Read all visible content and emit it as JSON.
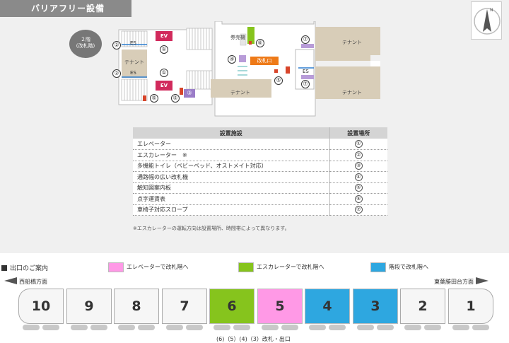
{
  "header": {
    "title": "バリアフリー設備"
  },
  "floor_badge": {
    "line1": "２階",
    "line2": "(改札階)"
  },
  "map": {
    "ev_label": "EV",
    "es_label": "ES",
    "tenant_label": "テナント",
    "ticket_machine_label": "券売機",
    "gate_label": "改札口",
    "markers": [
      "②",
      "①",
      "②",
      "①",
      "⑤",
      "⑤",
      "③",
      "④",
      "⑥",
      "⑦",
      "⑦",
      "⑤"
    ]
  },
  "facility_table": {
    "col_facility": "設置施設",
    "col_location": "設置場所",
    "rows": [
      {
        "name": "エレベーター",
        "mark": "①"
      },
      {
        "name": "エスカレーター　※",
        "mark": "②"
      },
      {
        "name": "多機能トイレ（ベビーベッド、オストメイト対応）",
        "mark": "③"
      },
      {
        "name": "通路幅の広い改札機",
        "mark": "④"
      },
      {
        "name": "触知図案内板",
        "mark": "⑤"
      },
      {
        "name": "点字運賃表",
        "mark": "⑥"
      },
      {
        "name": "車椅子対応スロープ",
        "mark": "⑦"
      }
    ],
    "note": "※エスカレーターの運転方向は設置場所、時間帯によって異なります。"
  },
  "exit_guide": {
    "title": "出口のご案内",
    "legend": [
      {
        "label": "エレベーターで改札階へ",
        "color": "#ff99e6"
      },
      {
        "label": "エスカレーターで改札階へ",
        "color": "#86c41d"
      },
      {
        "label": "階段で改札階へ",
        "color": "#2ea7e0"
      }
    ],
    "direction_left": "西船橋方面",
    "direction_right": "東葉勝田台方面",
    "cars": [
      {
        "number": "10",
        "color": "#f6f6f6"
      },
      {
        "number": "9",
        "color": "#f6f6f6"
      },
      {
        "number": "8",
        "color": "#f6f6f6"
      },
      {
        "number": "7",
        "color": "#f6f6f6"
      },
      {
        "number": "6",
        "color": "#86c41d"
      },
      {
        "number": "5",
        "color": "#ff99e6"
      },
      {
        "number": "4",
        "color": "#2ea7e0"
      },
      {
        "number": "3",
        "color": "#2ea7e0"
      },
      {
        "number": "2",
        "color": "#f6f6f6"
      },
      {
        "number": "1",
        "color": "#f6f6f6"
      }
    ],
    "car_note": "(6)（5）(4)（3）改札・出口"
  }
}
